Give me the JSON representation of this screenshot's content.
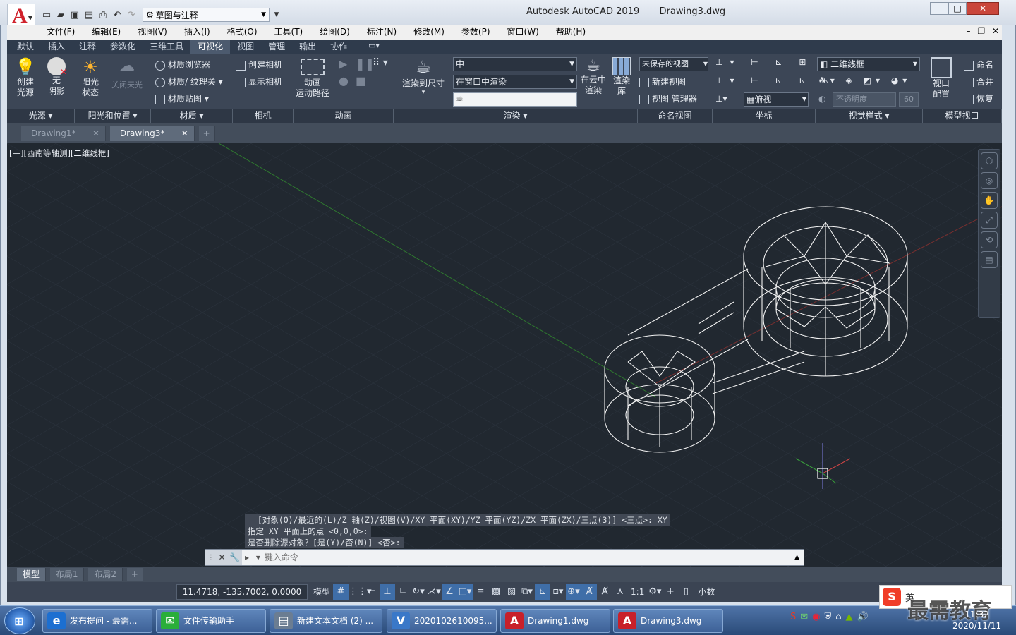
{
  "app": {
    "title": "Autodesk AutoCAD 2019",
    "filename": "Drawing3.dwg",
    "workspace": "草图与注释"
  },
  "menus": [
    "文件(F)",
    "编辑(E)",
    "视图(V)",
    "插入(I)",
    "格式(O)",
    "工具(T)",
    "绘图(D)",
    "标注(N)",
    "修改(M)",
    "参数(P)",
    "窗口(W)",
    "帮助(H)"
  ],
  "ribbon_tabs": [
    "默认",
    "插入",
    "注释",
    "参数化",
    "三维工具",
    "可视化",
    "视图",
    "管理",
    "输出",
    "协作"
  ],
  "ribbon": {
    "light": {
      "create_light": "创建\n光源",
      "no_shadow": "无\n阴影",
      "panel": "光源 ▾"
    },
    "sun": {
      "sun_state": "阳光\n状态",
      "sky_off": "关闭天光",
      "panel": "阳光和位置 ▾"
    },
    "materials": {
      "browser": "材质浏览器",
      "material_texture": "材质/ 纹理关",
      "mapping": "材质贴图",
      "panel": "材质 ▾"
    },
    "camera": {
      "create": "创建相机",
      "show": "显示相机",
      "panel": "相机"
    },
    "animation": {
      "motion_path": "动画\n运动路径",
      "panel": "动画"
    },
    "render": {
      "render_to_size": "渲染到尺寸",
      "quality": "中",
      "render_in": "在窗口中渲染",
      "cloud": "在云中\n渲染",
      "library": "渲染\n库",
      "panel": "渲染 ▾"
    },
    "named_views": {
      "unsaved": "未保存的视图",
      "new_view": "新建视图",
      "view_manager": "视图 管理器",
      "panel": "命名视图"
    },
    "coordinates": {
      "view": "俯视",
      "panel": "坐标"
    },
    "visual_styles": {
      "style": "二维线框",
      "opacity": "不透明度",
      "opacity_value": "60",
      "panel": "视觉样式 ▾"
    },
    "model_viewports": {
      "config": "视口\n配置",
      "name": "命名",
      "join": "合并",
      "restore": "恢复",
      "panel": "模型视口"
    }
  },
  "doc_tabs": [
    "Drawing1*",
    "Drawing3*"
  ],
  "viewport_label": "[—][西南等轴测][二维线框]",
  "command_history": [
    "  [对象(O)/最近的(L)/Z 轴(Z)/视图(V)/XY 平面(XY)/YZ 平面(YZ)/ZX 平面(ZX)/三点(3)] <三点>: XY",
    "指定 XY 平面上的点 <0,0,0>:",
    "是否删除源对象？[是(Y)/否(N)] <否>:"
  ],
  "command_placeholder": "键入命令",
  "layout_tabs": [
    "模型",
    "布局1",
    "布局2"
  ],
  "status": {
    "coords": "11.4718, -135.7002, 0.0000",
    "model": "模型",
    "scale": "1:1",
    "units": "小数"
  },
  "taskbar": {
    "items": [
      {
        "label": "发布提问 - 最需...",
        "color": "#1c6fd1",
        "glyph": "e"
      },
      {
        "label": "文件传输助手",
        "color": "#2aae3a",
        "glyph": "✉"
      },
      {
        "label": "新建文本文档 (2) ...",
        "color": "#6b7d92",
        "glyph": "▤"
      },
      {
        "label": "2020102610095...",
        "color": "#3a78c8",
        "glyph": "V"
      },
      {
        "label": "Drawing1.dwg",
        "color": "#c8202a",
        "glyph": "A"
      },
      {
        "label": "Drawing3.dwg",
        "color": "#c8202a",
        "glyph": "A"
      }
    ],
    "date": "2020/11/11",
    "time": "11:32",
    "ime": "英"
  },
  "watermark": "最需教育"
}
